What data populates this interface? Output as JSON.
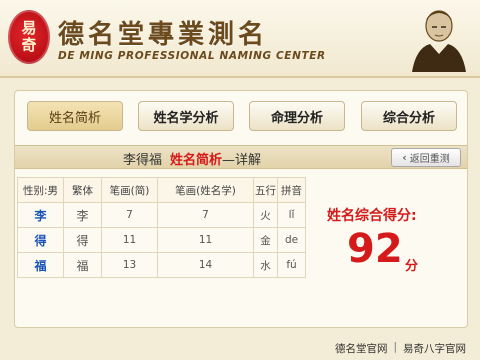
{
  "header": {
    "logo_text": [
      "易",
      "奇"
    ],
    "title": "德名堂專業測名",
    "subtitle": "DE MING PROFESSIONAL NAMING CENTER"
  },
  "tabs": [
    {
      "label": "姓名简析",
      "active": true
    },
    {
      "label": "姓名学分析",
      "active": false
    },
    {
      "label": "命理分析",
      "active": false
    },
    {
      "label": "综合分析",
      "active": false
    }
  ],
  "subbar": {
    "name": "李得福",
    "highlight": "姓名简析",
    "suffix": "—详解",
    "back_label": "返回重测",
    "back_icon": "chevron-left-icon"
  },
  "table": {
    "headers": [
      "性别:男",
      "繁体",
      "笔画(简)",
      "笔画(姓名学)",
      "五行",
      "拼音"
    ],
    "rows": [
      [
        "李",
        "李",
        "7",
        "7",
        "火",
        "lǐ"
      ],
      [
        "得",
        "得",
        "11",
        "11",
        "金",
        "de"
      ],
      [
        "福",
        "福",
        "13",
        "14",
        "水",
        "fú"
      ]
    ]
  },
  "score": {
    "label": "姓名综合得分:",
    "value": "92",
    "unit": "分"
  },
  "footer": {
    "links": [
      "德名堂官网",
      "易奇八字官网"
    ],
    "separator": "|"
  },
  "colors": {
    "accent_red": "#d41a1a",
    "char_blue": "#1a54b8",
    "brand_brown": "#6b4a1e",
    "background": "#f3ecd6"
  }
}
